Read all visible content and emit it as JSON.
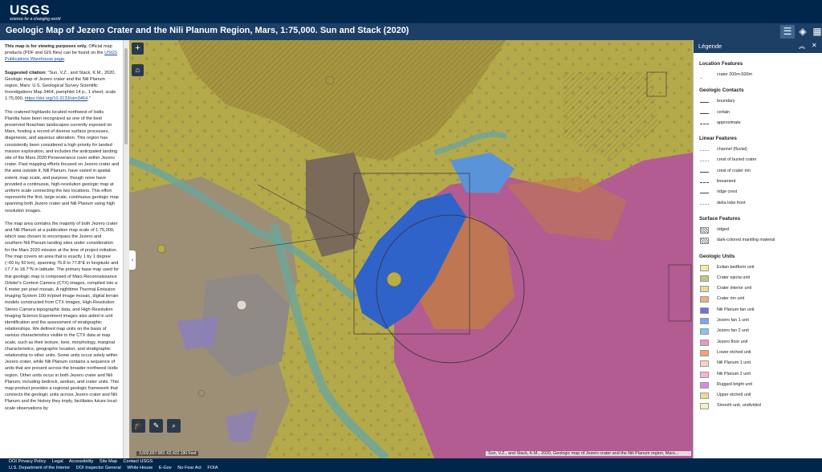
{
  "header": {
    "logo_text": "USGS",
    "logo_tagline": "science for a changing world",
    "title": "Geologic Map of Jezero Crater and the Nili Planum Region, Mars, 1:75,000. Sun and Stack (2020)",
    "buttons": [
      {
        "icon": "legend-list-icon"
      },
      {
        "icon": "layers-icon"
      },
      {
        "icon": "basemap-grid-icon"
      }
    ]
  },
  "sidepanel": {
    "p1_bold": "This map is for viewing purposes only.",
    "p1_text": " Official map products (PDF and GIS files) can be found on the ",
    "p1_link": "USGS Publications Warehouse page",
    "p1_end": ".",
    "p2_bold": "Suggested citation:",
    "p2_text": " \"Sun, V.Z., and Stack, K.M., 2020, Geologic map of Jezero crater and the Nili Planum region, Mars: U.S. Geological Survey Scientific Investigations Map 3464, pamphlet 14 p., 1 sheet, scale 1:75,000, ",
    "p2_link": "https://doi.org/10.3133/sim3464",
    "p2_end": ".\"",
    "p3": "The cratered highlands located northwest of Isidis Planitia have been recognized as one of the best preserved Noachian landscapes currently exposed on Mars, hosting a record of diverse surface processes, diagenesis, and aqueous alteration. This region has consistently been considered a high priority for landed mission exploration, and includes the anticipated landing site of the Mars 2020 Perseverance rover within Jezero crater. Past mapping efforts focused on Jezero crater and the area outside it, Nili Planum, have varied in spatial extent, map scale, and purpose, though none have provided a continuous, high-resolution geologic map at uniform scale connecting the two locations. This effort represents the first, large-scale, continuous geologic map spanning both Jezero crater and Nili Planum using high resolution images.",
    "p4": "The map area contains the majority of both Jezero crater and Nili Planum at a publication map scale of 1:75,000, which was chosen to encompass the Jezero and southern Nili Planum landing sites under consideration for the Mars 2020 mission at the time of project initiation. The map covers an area that is exactly 1 by 1 degree (~60 by 60 km), spanning 76.8 to 77.8°E in longitude and 17.7 to 18.7°N in latitude. The primary base map used for this geologic map is composed of Mars Reconnaissance Orbiter's Context Camera (CTX) images, compiled into a 6 meter per pixel mosaic. A nighttime Thermal Emission Imaging System 100 m/pixel image mosaic, digital terrain models constructed from CTX images, High-Resolution Stereo Camera topographic data, and High Resolution Imaging Science Experiment images also aided in unit identification and the assessment of stratigraphic relationships. We defined map units on the basis of various characteristics visible in the CTX data at map scale, such as their texture, tone, morphology, marginal characteristics, geographic location, and stratigraphic relationship to other units. Some units occur solely within Jezero crater, while Nili Planum contains a sequence of units that are present across the broader northwest Isidis region. Other units occur in both Jezero crater and Nili Planum, including bedrock, aeolian, and crater units. This map product provides a regional geologic framework that connects the geologic units across Jezero crater and Nili Planum and the history they imply, facilitates future local-scale observations by"
  },
  "map": {
    "zoom_in": "+",
    "home_icon": "home-icon",
    "coordinates": "3,602,657.083 -62,422.190 Feet",
    "attribution": "Sun, V.Z., and Stack, K.M., 2020, Geologic map of Jezero crater and the Nili Planum region, Mars...",
    "colors": {
      "olive": "#b9ac43",
      "tan_gray": "#9d8f75",
      "teal": "#6ea59b",
      "blue": "#2f63c9",
      "pink": "#b25c92",
      "orange": "#c07a48",
      "light_blue": "#5b93d8"
    },
    "tools": [
      {
        "icon": "graduation-cap-icon"
      },
      {
        "icon": "pencil-icon"
      },
      {
        "icon": "zoom-tool-icon"
      }
    ]
  },
  "legend": {
    "title": "Légende",
    "sections": [
      {
        "title": "Location Features",
        "items": [
          {
            "label": "crater 200m-500m",
            "sym": "dot"
          }
        ]
      },
      {
        "title": "Geologic Contacts",
        "items": [
          {
            "label": "boundary",
            "sym": "line"
          },
          {
            "label": "certain",
            "sym": "line"
          },
          {
            "label": "approximate",
            "sym": "dash"
          }
        ]
      },
      {
        "title": "Linear Features",
        "items": [
          {
            "label": "channel (fluvial)",
            "sym": "dot"
          },
          {
            "label": "crest of buried crater",
            "sym": "dot"
          },
          {
            "label": "crest of crater rim",
            "sym": "line"
          },
          {
            "label": "lineament",
            "sym": "dash"
          },
          {
            "label": "ridge crest",
            "sym": "line"
          },
          {
            "label": "delta lobe front",
            "sym": "dot"
          }
        ]
      },
      {
        "title": "Surface Features",
        "items": [
          {
            "label": "ridged",
            "sym": "hatch"
          },
          {
            "label": "dark-colored mantling material",
            "sym": "hatch"
          }
        ]
      },
      {
        "title": "Geologic Units",
        "items": [
          {
            "label": "Eolian bedform unit",
            "sym": "fill",
            "color": "#f3ec9d"
          },
          {
            "label": "Crater ejecta unit",
            "sym": "fill",
            "color": "#b9c98a"
          },
          {
            "label": "Crater interior unit",
            "sym": "fill",
            "color": "#e9d99b"
          },
          {
            "label": "Crater rim unit",
            "sym": "fill",
            "color": "#e6b28c"
          },
          {
            "label": "Nili Planum fan unit",
            "sym": "fill",
            "color": "#6f74d8"
          },
          {
            "label": "Jezero fan 1 unit",
            "sym": "fill",
            "color": "#7ea4ef"
          },
          {
            "label": "Jezero fan 2 unit",
            "sym": "fill",
            "color": "#86c6e9"
          },
          {
            "label": "Jezero floor unit",
            "sym": "fill",
            "color": "#e19cc4"
          },
          {
            "label": "Lower etched unit",
            "sym": "fill",
            "color": "#f2a07a"
          },
          {
            "label": "Nili Planum 1 unit",
            "sym": "fill",
            "color": "#f6d3c6"
          },
          {
            "label": "Nili Planum 2 unit",
            "sym": "fill",
            "color": "#f2b6d3"
          },
          {
            "label": "Rugged bright unit",
            "sym": "fill",
            "color": "#d48ce3"
          },
          {
            "label": "Upper etched unit",
            "sym": "fill",
            "color": "#efd98b"
          },
          {
            "label": "Smooth unit, undivided",
            "sym": "fill",
            "color": "#f6f1c2"
          }
        ]
      }
    ]
  },
  "footer": {
    "row1": [
      "DOI Privacy Policy",
      "Legal",
      "Accessibility",
      "Site Map",
      "Contact USGS"
    ],
    "row2": [
      "U.S. Department of the Interior",
      "DOI Inspector General",
      "White House",
      "E-Gov",
      "No Fear Act",
      "FOIA"
    ]
  }
}
